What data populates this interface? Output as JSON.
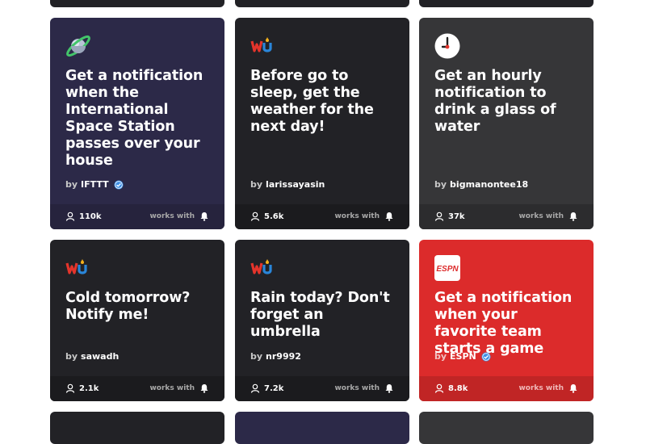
{
  "works_with_label": "works with",
  "by_label": "by",
  "cards": [
    {
      "title": "Get a notification when the International Space Station passes over your house",
      "author": "IFTTT",
      "verified": true,
      "users": "110k",
      "logo": "planet-icon",
      "color": "#2c2948"
    },
    {
      "title": "Before go to sleep, get the weather for the next day!",
      "author": "larissayasin",
      "verified": false,
      "users": "5.6k",
      "logo": "weather-underground-icon",
      "color": "#222226"
    },
    {
      "title": "Get an hourly notification to drink a glass of water",
      "author": "bigmanontee18",
      "verified": false,
      "users": "37k",
      "logo": "clock-icon",
      "color": "#363638"
    },
    {
      "title": "Cold tomorrow? Notify me!",
      "author": "sawadh",
      "verified": false,
      "users": "2.1k",
      "logo": "weather-underground-icon",
      "color": "#222226"
    },
    {
      "title": "Rain today? Don't forget an umbrella",
      "author": "nr9992",
      "verified": false,
      "users": "7.2k",
      "logo": "weather-underground-icon",
      "color": "#222226"
    },
    {
      "title": "Get a notification when your favorite team starts a game",
      "author": "ESPN",
      "verified": true,
      "users": "8.8k",
      "logo": "espn-icon",
      "logo_text": "ESPN",
      "color": "#dc2b2b"
    }
  ]
}
